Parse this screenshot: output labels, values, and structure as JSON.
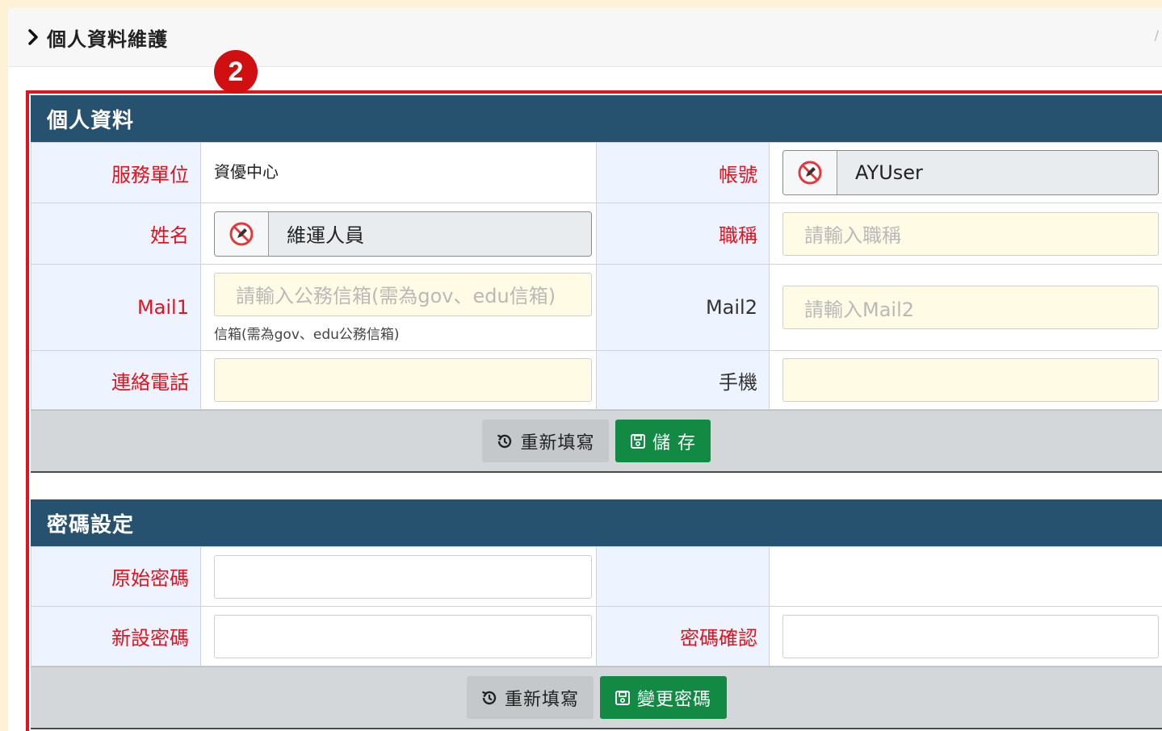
{
  "header": {
    "title": "個人資料維護",
    "separator": "/"
  },
  "step_badge": "2",
  "profile": {
    "title": "個人資料",
    "unit_label": "服務單位",
    "unit_value": "資優中心",
    "account_label": "帳號",
    "account_value": "AYUser",
    "name_label": "姓名",
    "name_value": "維運人員",
    "job_title_label": "職稱",
    "job_title_placeholder": "請輸入職稱",
    "mail1_label": "Mail1",
    "mail1_placeholder": "請輸入公務信箱(需為gov、edu信箱)",
    "mail1_help": "信箱(需為gov、edu公務信箱)",
    "mail2_label": "Mail2",
    "mail2_placeholder": "請輸入Mail2",
    "phone_label": "連絡電話",
    "mobile_label": "手機",
    "reset_label": "重新填寫",
    "save_label": "儲 存"
  },
  "password": {
    "title": "密碼設定",
    "old_label": "原始密碼",
    "new_label": "新設密碼",
    "confirm_label": "密碼確認",
    "reset_label": "重新填寫",
    "change_label": "變更密碼"
  },
  "icons": {
    "chevron": "chevron-right-icon",
    "readonly": "no-edit-icon",
    "reset": "history-icon",
    "save": "floppy-disk-icon"
  },
  "colors": {
    "header_bg": "#27526f",
    "required_label": "#e0141e",
    "save_button": "#138a44",
    "input_bg": "#fffbe5",
    "highlight_frame": "#e0141e"
  }
}
